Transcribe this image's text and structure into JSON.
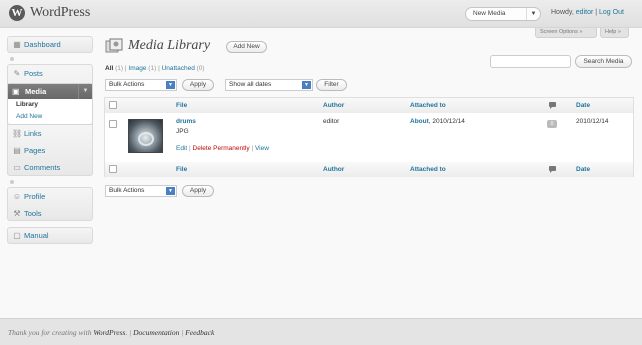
{
  "header": {
    "site_title": "WordPress",
    "favorite_action": "New Media",
    "howdy": "Howdy, ",
    "username": "editor",
    "separator": " | ",
    "logout": "Log Out",
    "screen_options": "Screen Options »",
    "help": "Help »"
  },
  "sidebar": {
    "dashboard": "Dashboard",
    "posts": "Posts",
    "media": "Media",
    "media_sub": [
      "Library",
      "Add New"
    ],
    "links": "Links",
    "pages": "Pages",
    "comments": "Comments",
    "profile": "Profile",
    "tools": "Tools",
    "manual": "Manual"
  },
  "main": {
    "title": "Media Library",
    "add_new": "Add New",
    "filters": {
      "all": "All",
      "all_count": "(1)",
      "image": "Image",
      "image_count": "(1)",
      "unattached": "Unattached",
      "unattached_count": "(0)",
      "sep": "|"
    },
    "search_placeholder": "",
    "search_button": "Search Media",
    "bulk_actions": "Bulk Actions",
    "apply": "Apply",
    "dates": "Show all dates",
    "filter": "Filter",
    "columns": {
      "file": "File",
      "author": "Author",
      "attached_to": "Attached to",
      "date": "Date"
    },
    "row": {
      "title": "drums",
      "type": "JPG",
      "edit": "Edit",
      "delete": "Delete Permanently",
      "view": "View",
      "sep": "|",
      "author": "editor",
      "attached_post": "About",
      "attached_date": ", 2010/12/14",
      "comments": "0",
      "date": "2010/12/14"
    }
  },
  "footer": {
    "thanks_pre": "Thank you for creating with ",
    "wordpress": "WordPress",
    "thanks_post": ".",
    "sep": " | ",
    "documentation": "Documentation",
    "feedback": "Feedback"
  }
}
